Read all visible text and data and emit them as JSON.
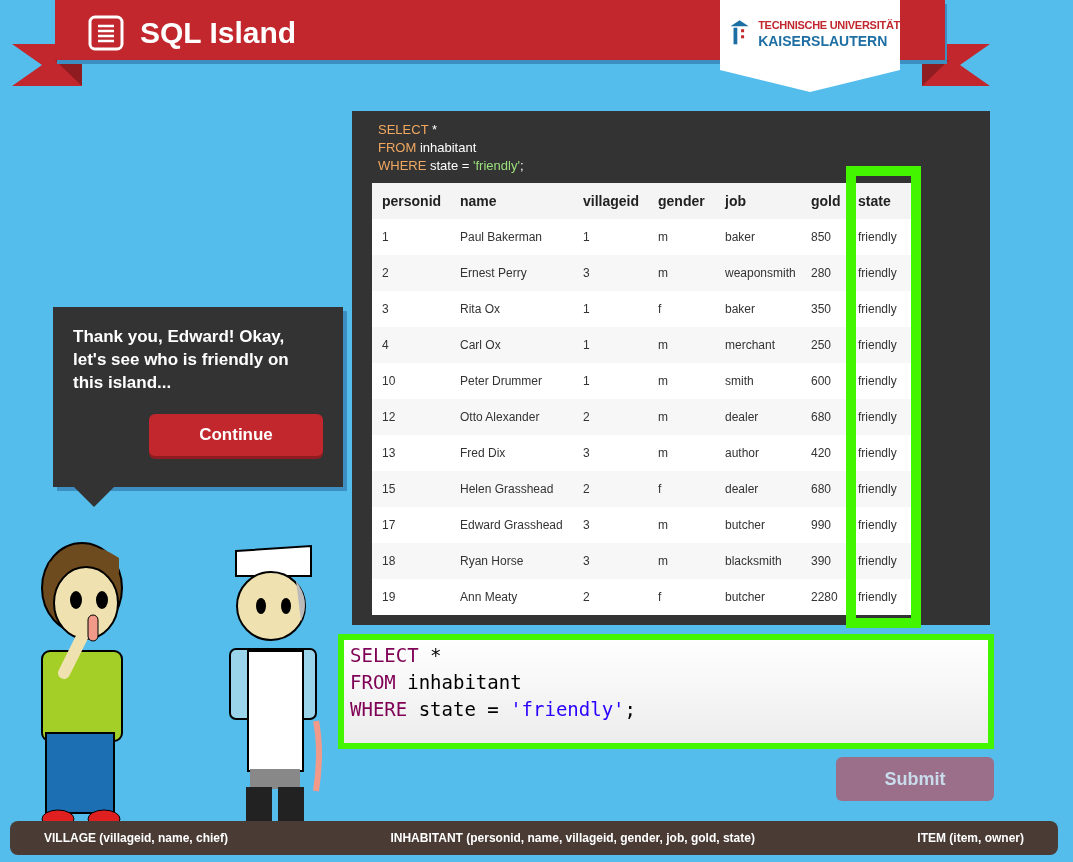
{
  "header": {
    "title": "SQL Island",
    "logo": {
      "line_1": "TECHNISCHE UNIVERSITÄT",
      "line_2": "KAISERSLAUTERN"
    }
  },
  "speech_bubble": {
    "text": "Thank you, Edward! Okay, let's see who is friendly on this island...",
    "button": "Continue"
  },
  "result": {
    "query": [
      [
        {
          "kind": "keyword",
          "text": "SELECT"
        },
        {
          "kind": "plain",
          "text": " *"
        }
      ],
      [
        {
          "kind": "keyword",
          "text": "FROM"
        },
        {
          "kind": "plain",
          "text": " inhabitant"
        }
      ],
      [
        {
          "kind": "keyword",
          "text": "WHERE"
        },
        {
          "kind": "plain",
          "text": " state = "
        },
        {
          "kind": "string",
          "text": "'friendly'"
        },
        {
          "kind": "plain",
          "text": ";"
        }
      ]
    ],
    "table": {
      "columns": [
        {
          "label": "personid",
          "highlighted": false
        },
        {
          "label": "name",
          "highlighted": false
        },
        {
          "label": "villageid",
          "highlighted": false
        },
        {
          "label": "gender",
          "highlighted": false
        },
        {
          "label": "job",
          "highlighted": false
        },
        {
          "label": "gold",
          "highlighted": false
        },
        {
          "label": "state",
          "highlighted": true
        }
      ],
      "rows": [
        [
          "1",
          "Paul Bakerman",
          "1",
          "m",
          "baker",
          "850",
          "friendly"
        ],
        [
          "2",
          "Ernest Perry",
          "3",
          "m",
          "weaponsmith",
          "280",
          "friendly"
        ],
        [
          "3",
          "Rita Ox",
          "1",
          "f",
          "baker",
          "350",
          "friendly"
        ],
        [
          "4",
          "Carl Ox",
          "1",
          "m",
          "merchant",
          "250",
          "friendly"
        ],
        [
          "10",
          "Peter Drummer",
          "1",
          "m",
          "smith",
          "600",
          "friendly"
        ],
        [
          "12",
          "Otto Alexander",
          "2",
          "m",
          "dealer",
          "680",
          "friendly"
        ],
        [
          "13",
          "Fred Dix",
          "3",
          "m",
          "author",
          "420",
          "friendly"
        ],
        [
          "15",
          "Helen Grasshead",
          "2",
          "f",
          "dealer",
          "680",
          "friendly"
        ],
        [
          "17",
          "Edward Grasshead",
          "3",
          "m",
          "butcher",
          "990",
          "friendly"
        ],
        [
          "18",
          "Ryan Horse",
          "3",
          "m",
          "blacksmith",
          "390",
          "friendly"
        ],
        [
          "19",
          "Ann Meaty",
          "2",
          "f",
          "butcher",
          "2280",
          "friendly"
        ]
      ]
    }
  },
  "editor": {
    "highlighted": true,
    "lines": [
      [
        {
          "kind": "keyword",
          "text": "SELECT"
        },
        {
          "kind": "plain",
          "text": " *"
        }
      ],
      [
        {
          "kind": "keyword",
          "text": "FROM"
        },
        {
          "kind": "plain",
          "text": " inhabitant"
        }
      ],
      [
        {
          "kind": "keyword",
          "text": "WHERE"
        },
        {
          "kind": "plain",
          "text": " state = "
        },
        {
          "kind": "string",
          "text": "'friendly'"
        },
        {
          "kind": "plain",
          "text": ";"
        }
      ]
    ]
  },
  "submit": {
    "label": "Submit",
    "disabled": true
  },
  "schema_bar": [
    "VILLAGE (villageid, name, chief)",
    "INHABITANT (personid, name, villageid, gender, job, gold, state)",
    "ITEM (item, owner)"
  ]
}
